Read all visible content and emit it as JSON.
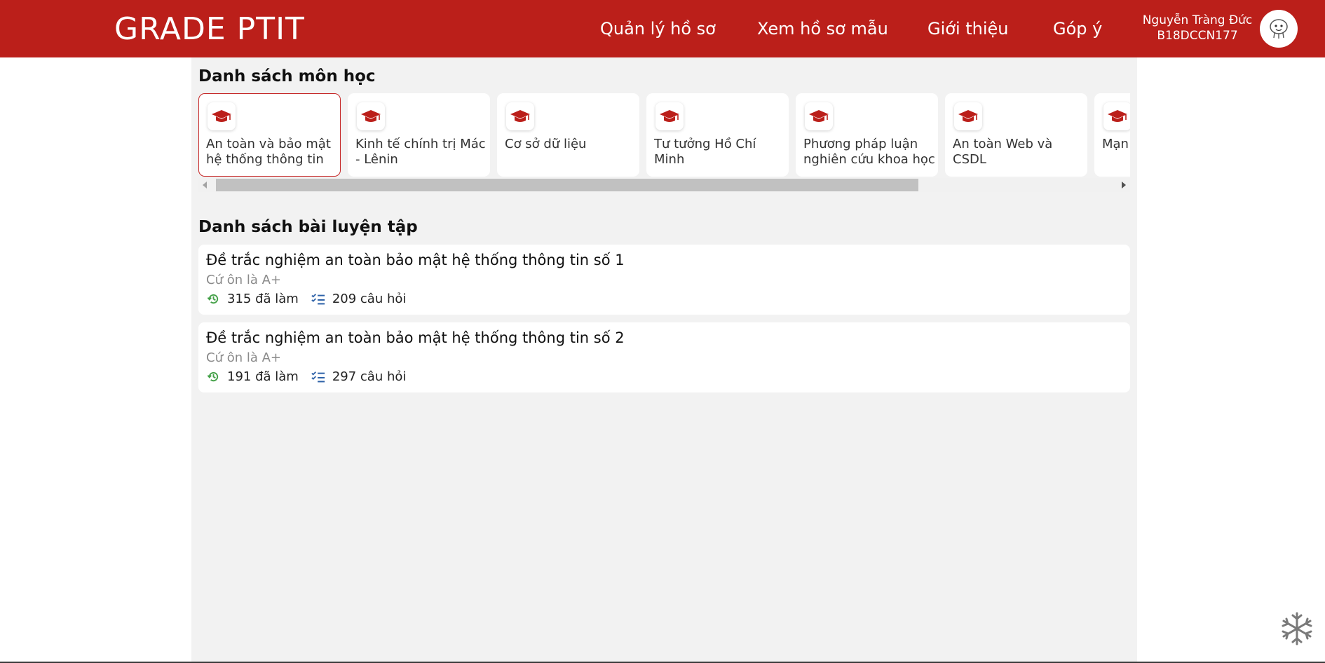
{
  "header": {
    "brand": "GRADE PTIT",
    "nav": [
      "Quản lý hồ sơ",
      "Xem hồ sơ mẫu",
      "Giới thiệu",
      "Góp ý"
    ],
    "user_name": "Nguyễn Tràng Đức",
    "user_id": "B18DCCN177",
    "background_color": "#bb1f1a"
  },
  "subjects": {
    "title": "Danh sách môn học",
    "items": [
      {
        "label": "An toàn và bảo mật hệ thống thông tin",
        "icon": "graduation-cap-icon"
      },
      {
        "label": "Kinh tế chính trị Mác - Lênin",
        "icon": "graduation-cap-icon"
      },
      {
        "label": "Cơ sở dữ liệu",
        "icon": "graduation-cap-icon"
      },
      {
        "label": "Tư tưởng Hồ Chí Minh",
        "icon": "graduation-cap-icon"
      },
      {
        "label": "Phương pháp luận nghiên cứu khoa học",
        "icon": "graduation-cap-icon"
      },
      {
        "label": "An toàn Web và CSDL",
        "icon": "graduation-cap-icon"
      },
      {
        "label": "Mạn",
        "icon": "graduation-cap-icon"
      }
    ],
    "selected_index": 0,
    "accent_color": "#c62828"
  },
  "exercises": {
    "title": "Danh sách bài luyện tập",
    "items": [
      {
        "title": "Đề trắc nghiệm an toàn bảo mật hệ thống thông tin số 1",
        "subtitle": "Cứ ôn là A+",
        "attempts": "315 đã làm",
        "questions": "209 câu hỏi"
      },
      {
        "title": "Đề trắc nghiệm an toàn bảo mật hệ thống thông tin số 2",
        "subtitle": "Cứ ôn là A+",
        "attempts": "191 đã làm",
        "questions": "297 câu hỏi"
      }
    ],
    "attempt_icon_color": "#43a047",
    "question_icon_color": "#2e62a8"
  }
}
